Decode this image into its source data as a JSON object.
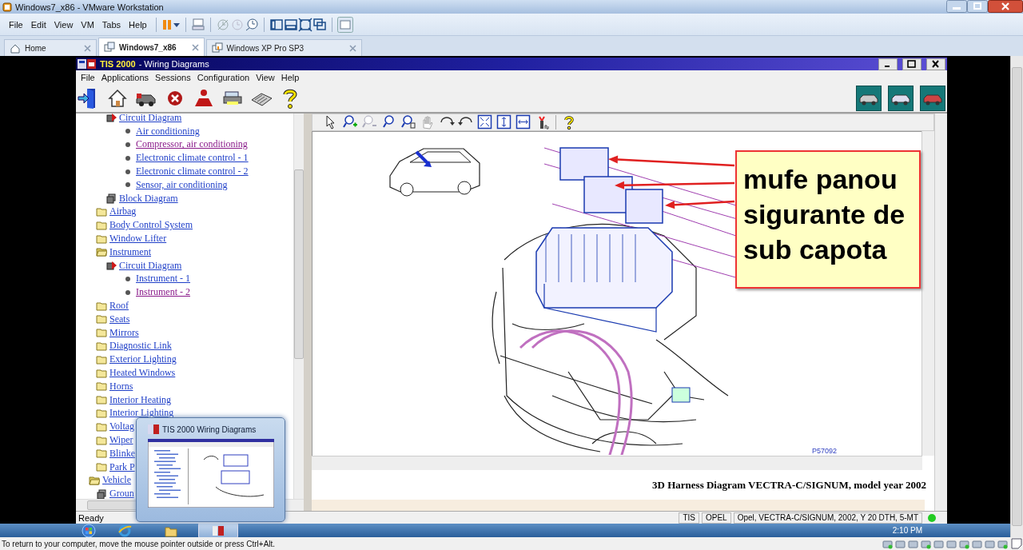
{
  "host_window": {
    "title": "Windows7_x86 - VMware Workstation"
  },
  "host_menu": [
    "File",
    "Edit",
    "View",
    "VM",
    "Tabs",
    "Help"
  ],
  "host_tabs": [
    {
      "label": "Home",
      "selected": false
    },
    {
      "label": "Windows7_x86",
      "selected": true
    },
    {
      "label": "Windows XP Pro SP3",
      "selected": false
    }
  ],
  "app_window": {
    "title": "TIS 2000",
    "subtitle": "- Wiring Diagrams"
  },
  "app_menu": [
    "File",
    "Applications",
    "Sessions",
    "Configuration",
    "View",
    "Help"
  ],
  "tree": {
    "items": [
      {
        "children": [
          {
            "children": [
              {
                "label": "Circuit Diagram",
                "kind": "circuit",
                "visited": false,
                "children": [
                  {
                    "label": "Air conditioning",
                    "kind": "page",
                    "visited": false
                  },
                  {
                    "label": "Compressor, air conditioning",
                    "kind": "page",
                    "visited": true
                  },
                  {
                    "label": "Electronic climate control - 1",
                    "kind": "page",
                    "visited": false
                  },
                  {
                    "label": "Electronic climate control - 2",
                    "kind": "page",
                    "visited": false
                  },
                  {
                    "label": "Sensor, air conditioning",
                    "kind": "page",
                    "visited": false
                  }
                ]
              },
              {
                "label": "Block Diagram",
                "kind": "block",
                "visited": false
              }
            ]
          },
          {
            "label": "Airbag",
            "kind": "folder",
            "expanded": false,
            "visited": false
          },
          {
            "label": "Body Control System",
            "kind": "folder",
            "expanded": false,
            "visited": false
          },
          {
            "label": "Window Lifter",
            "kind": "folder",
            "expanded": false,
            "visited": false
          },
          {
            "label": "Instrument",
            "kind": "folder",
            "expanded": true,
            "visited": false,
            "children": [
              {
                "label": "Circuit Diagram",
                "kind": "circuit",
                "visited": false,
                "children": [
                  {
                    "label": "Instrument - 1",
                    "kind": "page",
                    "visited": false
                  },
                  {
                    "label": "Instrument - 2",
                    "kind": "page",
                    "visited": true
                  }
                ]
              }
            ]
          },
          {
            "label": "Roof",
            "kind": "folder",
            "expanded": false,
            "visited": false
          },
          {
            "label": "Seats",
            "kind": "folder",
            "expanded": false,
            "visited": false
          },
          {
            "label": "Mirrors",
            "kind": "folder",
            "expanded": false,
            "visited": false
          },
          {
            "label": "Diagnostic Link",
            "kind": "folder",
            "expanded": false,
            "visited": false
          },
          {
            "label": "Exterior Lighting",
            "kind": "folder",
            "expanded": false,
            "visited": false
          },
          {
            "label": "Heated Windows",
            "kind": "folder",
            "expanded": false,
            "visited": false
          },
          {
            "label": "Horns",
            "kind": "folder",
            "expanded": false,
            "visited": false
          },
          {
            "label": "Interior Heating",
            "kind": "folder",
            "expanded": false,
            "visited": false
          },
          {
            "label": "Interior Lighting",
            "kind": "folder",
            "expanded": false,
            "visited": false
          },
          {
            "label": "Voltag",
            "kind": "folder",
            "expanded": false,
            "visited": false
          },
          {
            "label": "Wiper",
            "kind": "folder",
            "expanded": false,
            "visited": false
          },
          {
            "label": "Blinke",
            "kind": "folder",
            "expanded": false,
            "visited": false
          },
          {
            "label": "Park P",
            "kind": "folder",
            "expanded": false,
            "visited": false
          }
        ]
      },
      {
        "label": "Vehicle",
        "kind": "folder",
        "expanded": true,
        "visited": false,
        "children": [
          {
            "label": "Groun",
            "kind": "block",
            "visited": false
          }
        ]
      }
    ]
  },
  "diagram": {
    "callout": [
      "mufe panou",
      "sigurante de",
      "sub capota"
    ],
    "figure_id": "P57092",
    "caption": "3D Harness Diagram VECTRA-C/SIGNUM, model year 2002"
  },
  "status_bar": {
    "message": "Ready",
    "fields": [
      "TIS",
      "OPEL",
      "Opel, VECTRA-C/SIGNUM, 2002, Y 20 DTH, 5-MT"
    ],
    "online": true
  },
  "preview": {
    "title": "TIS 2000 Wiring Diagrams"
  },
  "taskbar": {
    "apps": [
      {
        "kind": "browser",
        "selected": false
      },
      {
        "kind": "folder",
        "selected": false
      },
      {
        "kind": "tis",
        "selected": true
      }
    ],
    "time": "2:10 PM"
  },
  "host_status": {
    "message": "To return to your computer, move the mouse pointer outside or press Ctrl+Alt."
  }
}
